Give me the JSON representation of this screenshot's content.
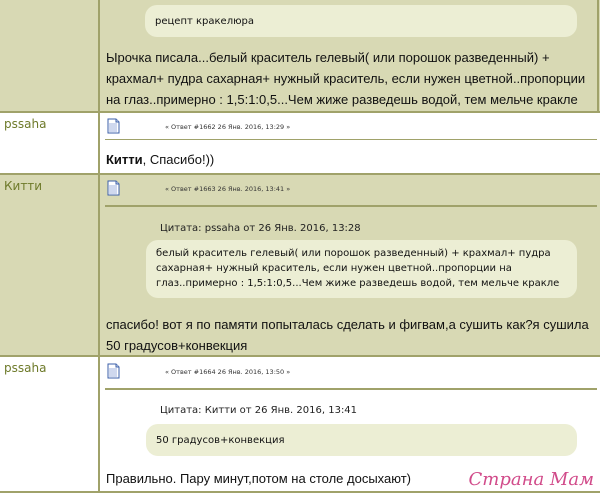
{
  "post0": {
    "quote_text": "рецепт кракелюра",
    "body": "Ырочка писала...белый краситель гелевый( или порошок разведенный) + крахмал+ пудра сахарная+ нужный краситель, если нужен цветной..пропорции на глаз..примерно : 1,5:1:0,5...Чем жиже разведешь водой, тем мельче кракле"
  },
  "post1": {
    "author": "pssaha",
    "meta": "« Ответ #1662 26 Янв. 2016, 13:29 »",
    "addressee": "Китти",
    "body_rest": ", Спасибо!))"
  },
  "post2": {
    "author": "Китти",
    "meta": "« Ответ #1663 26 Янв. 2016, 13:41 »",
    "quote_header": "Цитата: pssaha от 26 Янв. 2016, 13:28",
    "quote_text": "белый краситель гелевый( или порошок разведенный) + крахмал+ пудра сахарная+ нужный краситель, если нужен цветной..пропорции на глаз..примерно : 1,5:1:0,5...Чем жиже разведешь водой, тем мельче кракле",
    "body": "спасибо! вот я по памяти попыталась сделать и фигвам,а сушить как?я сушила 50 градусов+конвекция"
  },
  "post3": {
    "author": "pssaha",
    "meta": "« Ответ #1664 26 Янв. 2016, 13:50 »",
    "quote_header": "Цитата: Китти от 26 Янв. 2016, 13:41",
    "quote_text": "50 градусов+конвекция",
    "body": "Правильно. Пару минут,потом на столе досыхают)"
  },
  "watermark": "Страна Мам",
  "icons": {
    "post_icon": "document-icon"
  },
  "colors": {
    "olive": "#d8d9b4",
    "quote": "#eceed4",
    "author": "#6e7a2a",
    "border": "#a0a26a",
    "watermark": "#d14b8a"
  }
}
